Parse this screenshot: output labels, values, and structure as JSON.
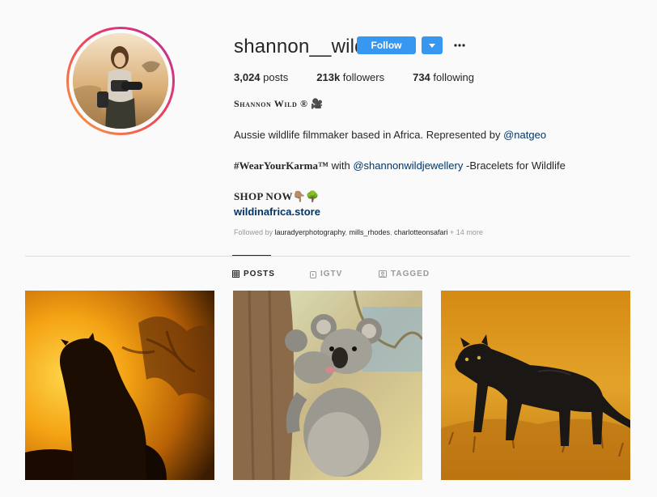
{
  "profile": {
    "username": "shannon__wild",
    "follow_label": "Follow",
    "stats": {
      "posts_count": "3,024",
      "posts_label": "posts",
      "followers_count": "213k",
      "followers_label": "followers",
      "following_count": "734",
      "following_label": "following"
    },
    "full_name": "Shannon Wild ®",
    "name_emoji": "🎥",
    "bio": {
      "line1_text": "Aussie wildlife filmmaker based in Africa. Represented by ",
      "line1_mention": "@natgeo",
      "line2_hashtag": "#WearYourKarma™",
      "line2_with": " with ",
      "line2_mention": "@shannonwildjewellery",
      "line2_rest": " -Bracelets for Wildlife",
      "shop_label": "SHOP NOW👇🏽🌳",
      "website": "wildinafrica.store"
    },
    "followed_by": {
      "prefix": "Followed by ",
      "account1": "lauradyerphotography",
      "account2": "mills_rhodes",
      "account3": "charlotteonsafari",
      "more": " + 14 more"
    }
  },
  "tabs": [
    {
      "label": "POSTS",
      "icon": "grid-icon",
      "active": true
    },
    {
      "label": "IGTV",
      "icon": "igtv-icon",
      "active": false
    },
    {
      "label": "TAGGED",
      "icon": "tagged-icon",
      "active": false
    }
  ],
  "posts": [
    {
      "subject": "leopard silhouette at sunset",
      "icon": "post-image"
    },
    {
      "subject": "koala with joey on tree",
      "icon": "post-image"
    },
    {
      "subject": "black panther walking in golden grass",
      "icon": "post-image"
    }
  ],
  "colors": {
    "primary_blue": "#3897f0",
    "link": "#003569",
    "background": "#fafafa",
    "text": "#262626",
    "muted": "#999999"
  }
}
